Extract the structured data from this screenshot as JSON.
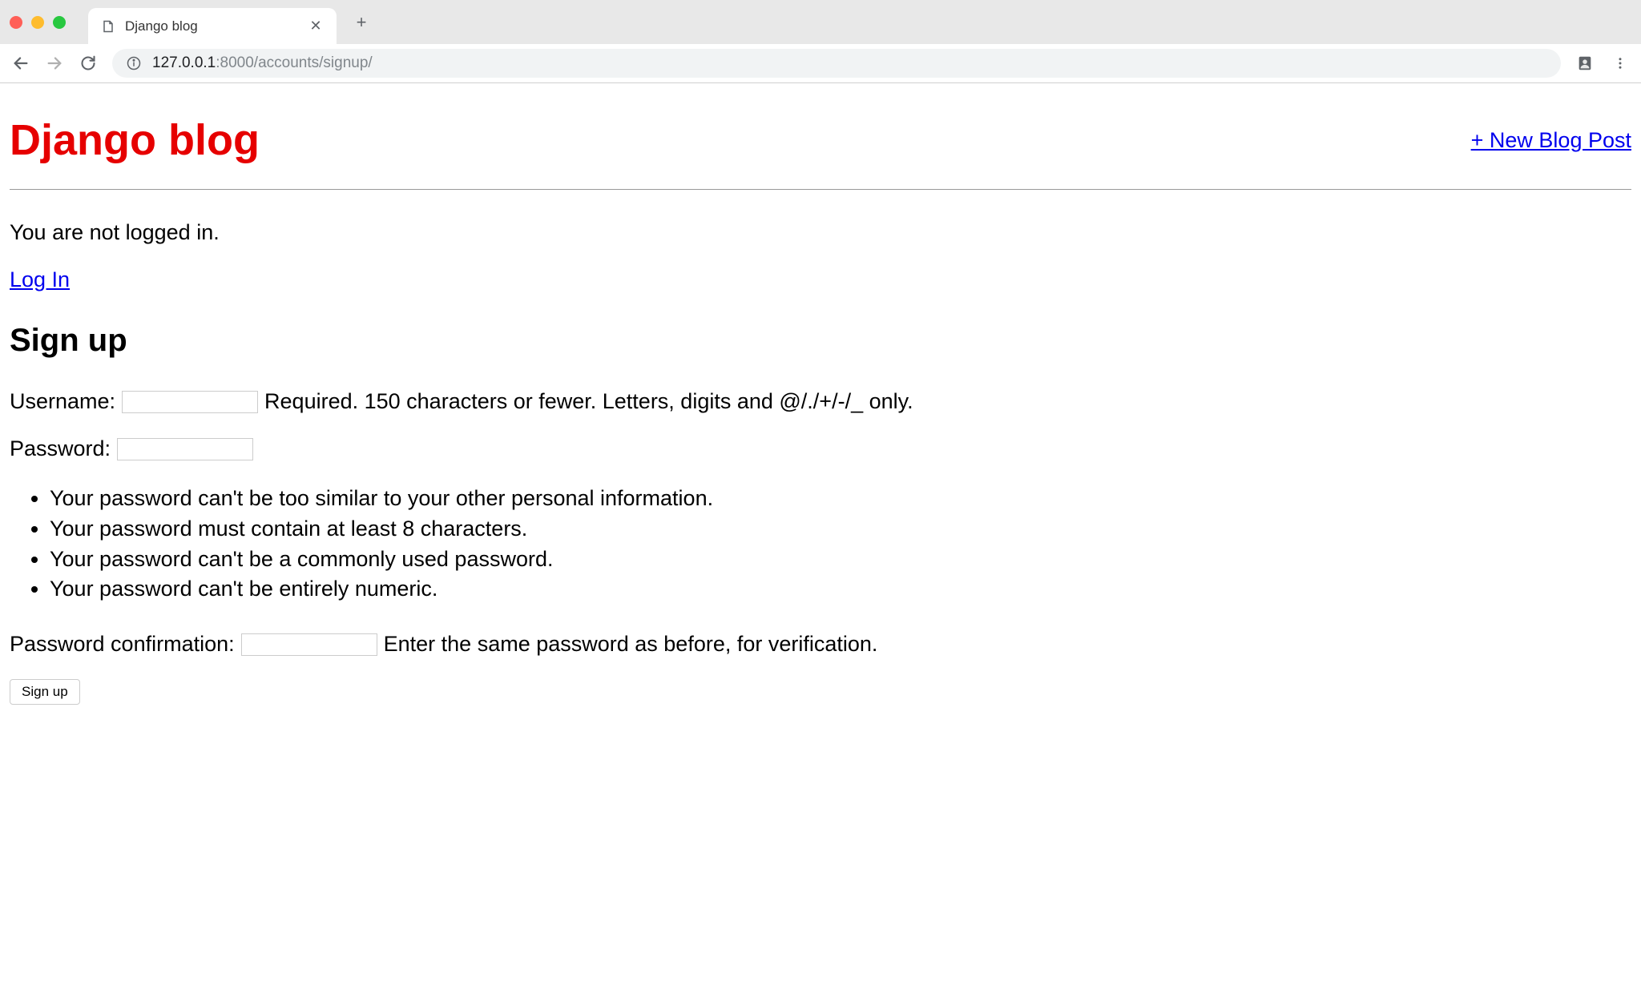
{
  "browser": {
    "tab_title": "Django blog",
    "url_host": "127.0.0.1",
    "url_port": ":8000",
    "url_path": "/accounts/signup/"
  },
  "page": {
    "site_title": "Django blog",
    "new_post_link": "+ New Blog Post",
    "status_text": "You are not logged in.",
    "login_link": "Log In",
    "signup_heading": "Sign up",
    "form": {
      "username_label": "Username:",
      "username_help": "Required. 150 characters or fewer. Letters, digits and @/./+/-/_ only.",
      "password_label": "Password:",
      "password_rules": [
        "Your password can't be too similar to your other personal information.",
        "Your password must contain at least 8 characters.",
        "Your password can't be a commonly used password.",
        "Your password can't be entirely numeric."
      ],
      "password_confirm_label": "Password confirmation:",
      "password_confirm_help": "Enter the same password as before, for verification.",
      "submit_label": "Sign up"
    }
  }
}
